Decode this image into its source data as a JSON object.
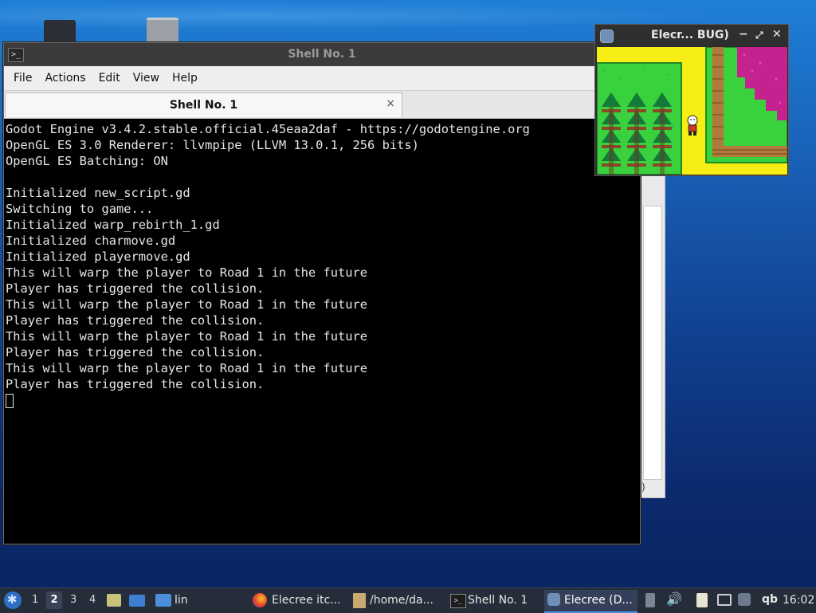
{
  "terminal": {
    "title": "Shell No. 1",
    "menu": [
      "File",
      "Actions",
      "Edit",
      "View",
      "Help"
    ],
    "tab_label": "Shell No. 1",
    "tab_close": "×",
    "lines": [
      "Godot Engine v3.4.2.stable.official.45eaa2daf - https://godotengine.org",
      "OpenGL ES 3.0 Renderer: llvmpipe (LLVM 13.0.1, 256 bits)",
      "OpenGL ES Batching: ON",
      "",
      "Initialized new_script.gd",
      "Switching to game...",
      "Initialized warp_rebirth_1.gd",
      "Initialized charmove.gd",
      "Initialized playermove.gd",
      "This will warp the player to Road 1 in the future",
      "Player has triggered the collision.",
      "This will warp the player to Road 1 in the future",
      "Player has triggered the collision.",
      "This will warp the player to Road 1 in the future",
      "Player has triggered the collision.",
      "This will warp the player to Road 1 in the future",
      "Player has triggered the collision."
    ]
  },
  "game_window": {
    "title": "Elecr... BUG)",
    "min": "−",
    "max": "⤢",
    "close": "✕"
  },
  "back_window": {
    "text": ")"
  },
  "taskbar": {
    "workspaces": [
      "1",
      "2",
      "3",
      "4"
    ],
    "active_workspace": "2",
    "folder_label": "lin",
    "tasks": [
      {
        "label": "Elecree itc...",
        "icon": "firefox-icon"
      },
      {
        "label": "/home/da...",
        "icon": "archive-icon"
      },
      {
        "label": "Shell No. 1",
        "icon": "terminal-icon"
      },
      {
        "label": "Elecree (D...",
        "icon": "godot-icon",
        "active": true
      }
    ],
    "tray_text": "qb",
    "clock": "16:02"
  },
  "colors": {
    "taskbar_bg": "#252d3a",
    "terminal_bg": "#000000",
    "terminal_fg": "#e6e6e6",
    "game_yellow": "#f6ee14",
    "grass": "#3ad13f",
    "magenta": "#c4238f"
  }
}
